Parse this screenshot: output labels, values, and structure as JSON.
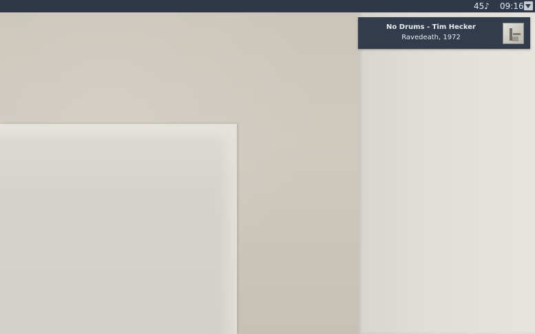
{
  "topbar": {
    "volume": "45♪",
    "clock": "09:16",
    "menu_icon": "triangle-down-icon"
  },
  "notification": {
    "title": "No Drums - Tim Hecker",
    "body": "Ravedeath, 1972",
    "album_art_icon": "album-cover-thumbnail"
  },
  "desktop": {
    "wallpaper": "photo of paper sheet against a wall"
  },
  "colors": {
    "topbar_bg": "#2f3849",
    "notification_bg": "#323c4d",
    "text_light": "#e8ebf0"
  }
}
